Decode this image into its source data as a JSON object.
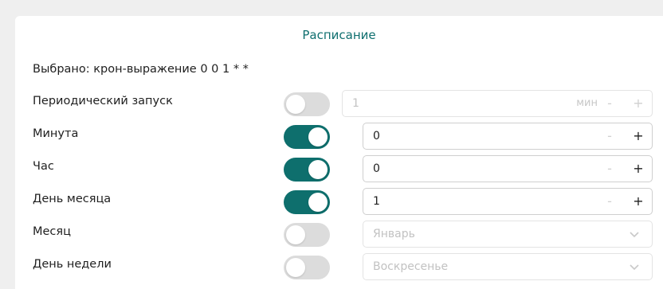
{
  "schedule": {
    "title": "Расписание",
    "selected_text": "Выбрано: крон-выражение 0 0 1 * *"
  },
  "rows": [
    {
      "label": "Периодический запуск",
      "enabled": false,
      "value": "1",
      "unit": "мин",
      "minus": "-",
      "plus": "+"
    },
    {
      "label": "Минута",
      "enabled": true,
      "value": "0",
      "minus": "-",
      "plus": "+"
    },
    {
      "label": "Час",
      "enabled": true,
      "value": "0",
      "minus": "-",
      "plus": "+"
    },
    {
      "label": "День месяца",
      "enabled": true,
      "value": "1",
      "minus": "-",
      "plus": "+"
    },
    {
      "label": "Месяц",
      "enabled": false,
      "value": "Январь"
    },
    {
      "label": "День недели",
      "enabled": false,
      "value": "Воскресенье"
    }
  ],
  "colors": {
    "accent": "#0e6f6d",
    "title": "#0f6f6f",
    "toggle_off": "#dcdcdc"
  },
  "icons": {
    "select_arrow": "chevron-down-icon"
  }
}
